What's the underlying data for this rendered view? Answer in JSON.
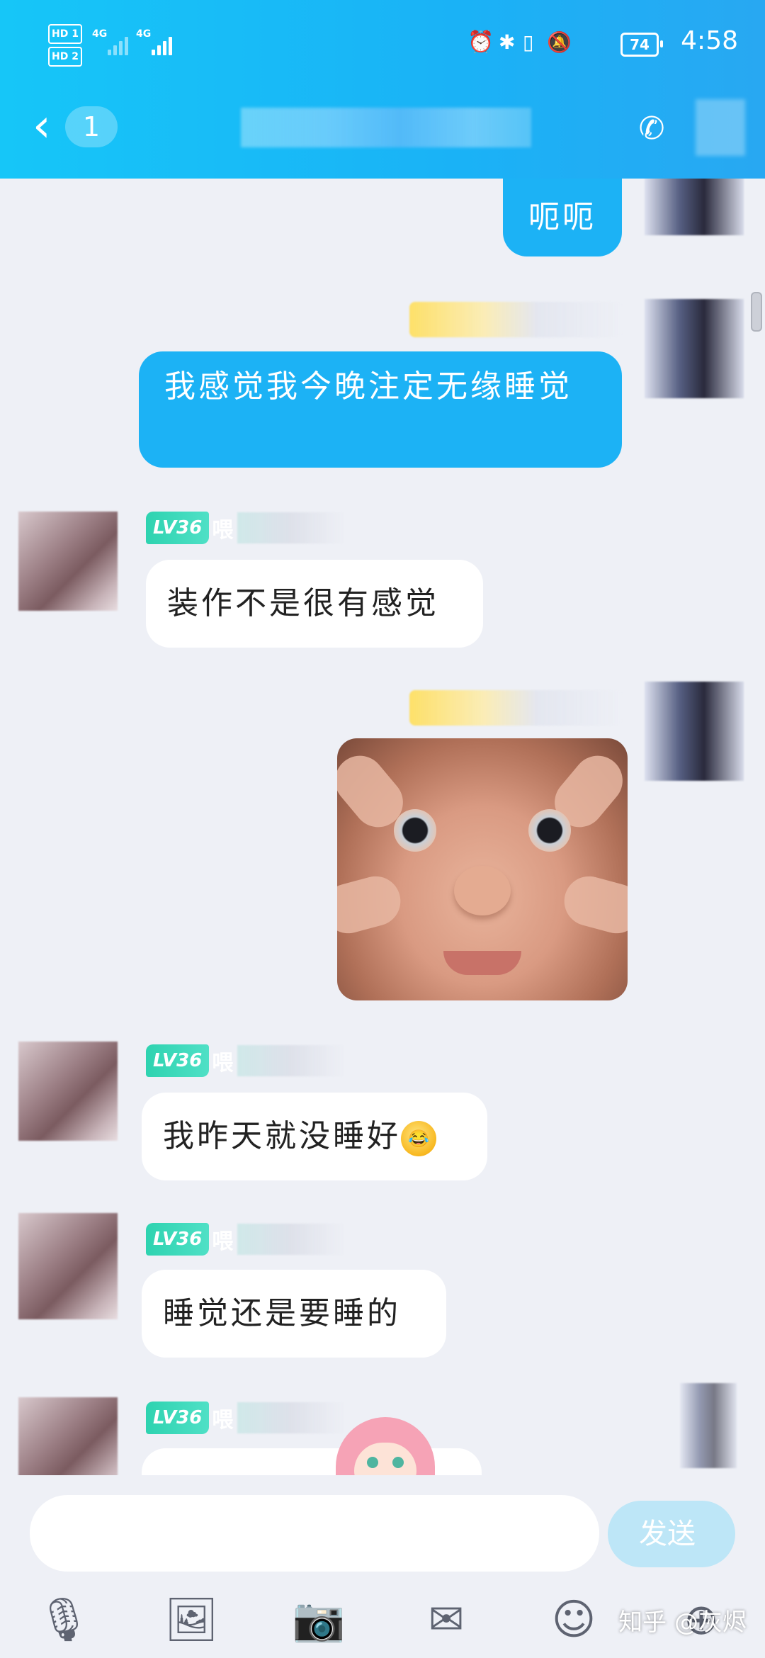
{
  "status_bar": {
    "sim1_label": "HD 1",
    "sim2_label": "HD 2",
    "network1": "4G",
    "network2": "4G",
    "battery": "74",
    "time": "4:58"
  },
  "header": {
    "back_icon": "chevron-left-icon",
    "unread_count": "1",
    "right_icon": "call-icon"
  },
  "messages": [
    {
      "side": "sent",
      "type": "text",
      "text": "呃呃"
    },
    {
      "side": "sent",
      "type": "text",
      "text": "我感觉我今晚注定无缘睡觉"
    },
    {
      "side": "received",
      "type": "text",
      "level": "LV36",
      "name": "喂",
      "text": "装作不是很有感觉"
    },
    {
      "side": "sent",
      "type": "image",
      "description": "child-face-sticker"
    },
    {
      "side": "received",
      "type": "text",
      "level": "LV36",
      "name": "喂",
      "text": "我昨天就没睡好",
      "emoji": "crying-laughing-emoji"
    },
    {
      "side": "received",
      "type": "text",
      "level": "LV36",
      "name": "喂",
      "text": "睡觉还是要睡的"
    },
    {
      "side": "received",
      "type": "text",
      "level": "LV36",
      "name": "喂",
      "text": ""
    }
  ],
  "input": {
    "placeholder": "",
    "send_label": "发送"
  },
  "toolbar": [
    "microphone-icon",
    "image-icon",
    "camera-icon",
    "red-packet-icon",
    "emoji-icon",
    "plus-icon"
  ],
  "watermark": "知乎 @灰烬",
  "colors": {
    "header_blue": "#1ab2f6",
    "sent_bubble": "#1cb2f5",
    "level_badge": "#2ed3b0",
    "background": "#eef0f6"
  }
}
